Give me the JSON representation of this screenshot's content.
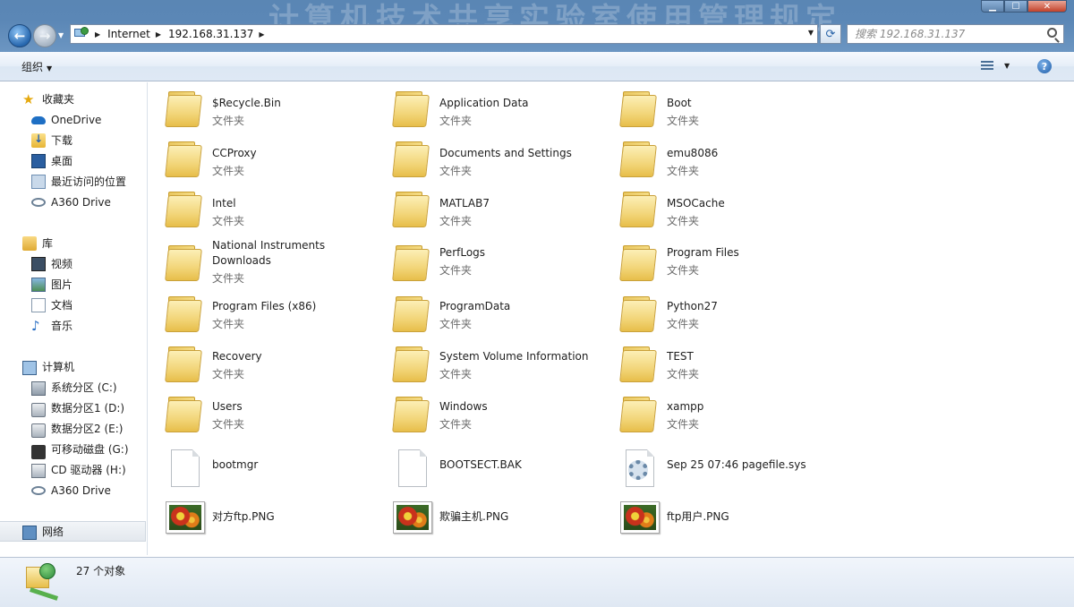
{
  "window": {
    "watermark": "计算机技术共享实验室使用管理规定"
  },
  "address": {
    "breadcrumbs": [
      "Internet",
      "192.168.31.137"
    ]
  },
  "search": {
    "placeholder": "搜索 192.168.31.137"
  },
  "toolbar": {
    "organize_label": "组织"
  },
  "sidebar": {
    "favorites": {
      "label": "收藏夹",
      "items": [
        {
          "label": "OneDrive",
          "icon": "cloud-icon"
        },
        {
          "label": "下载",
          "icon": "download-folder-icon"
        },
        {
          "label": "桌面",
          "icon": "desktop-icon"
        },
        {
          "label": "最近访问的位置",
          "icon": "recent-places-icon"
        },
        {
          "label": "A360 Drive",
          "icon": "a360-drive-icon"
        }
      ]
    },
    "libraries": {
      "label": "库",
      "items": [
        {
          "label": "视频",
          "icon": "video-icon"
        },
        {
          "label": "图片",
          "icon": "pictures-icon"
        },
        {
          "label": "文档",
          "icon": "documents-icon"
        },
        {
          "label": "音乐",
          "icon": "music-icon"
        }
      ]
    },
    "computer": {
      "label": "计算机",
      "items": [
        {
          "label": "系统分区 (C:)",
          "icon": "system-drive-icon"
        },
        {
          "label": "数据分区1 (D:)",
          "icon": "hard-drive-icon"
        },
        {
          "label": "数据分区2 (E:)",
          "icon": "hard-drive-icon"
        },
        {
          "label": "可移动磁盘 (G:)",
          "icon": "removable-drive-icon"
        },
        {
          "label": "CD 驱动器 (H:)",
          "icon": "cd-drive-icon"
        },
        {
          "label": "A360 Drive",
          "icon": "a360-drive-icon"
        }
      ]
    },
    "network": {
      "label": "网络"
    }
  },
  "files": [
    {
      "name": "$Recycle.Bin",
      "type": "文件夹",
      "kind": "folder"
    },
    {
      "name": "Application Data",
      "type": "文件夹",
      "kind": "folder"
    },
    {
      "name": "Boot",
      "type": "文件夹",
      "kind": "folder"
    },
    {
      "name": "CCProxy",
      "type": "文件夹",
      "kind": "folder"
    },
    {
      "name": "Documents and Settings",
      "type": "文件夹",
      "kind": "folder"
    },
    {
      "name": "emu8086",
      "type": "文件夹",
      "kind": "folder"
    },
    {
      "name": "Intel",
      "type": "文件夹",
      "kind": "folder"
    },
    {
      "name": "MATLAB7",
      "type": "文件夹",
      "kind": "folder"
    },
    {
      "name": "MSOCache",
      "type": "文件夹",
      "kind": "folder"
    },
    {
      "name": "National Instruments Downloads",
      "name_lines": [
        "National Instruments",
        "Downloads"
      ],
      "type": "文件夹",
      "kind": "folder"
    },
    {
      "name": "PerfLogs",
      "type": "文件夹",
      "kind": "folder"
    },
    {
      "name": "Program Files",
      "type": "文件夹",
      "kind": "folder"
    },
    {
      "name": "Program Files (x86)",
      "type": "文件夹",
      "kind": "folder"
    },
    {
      "name": "ProgramData",
      "type": "文件夹",
      "kind": "folder"
    },
    {
      "name": "Python27",
      "type": "文件夹",
      "kind": "folder"
    },
    {
      "name": "Recovery",
      "type": "文件夹",
      "kind": "folder"
    },
    {
      "name": "System Volume Information",
      "type": "文件夹",
      "kind": "folder"
    },
    {
      "name": "TEST",
      "type": "文件夹",
      "kind": "folder"
    },
    {
      "name": "Users",
      "type": "文件夹",
      "kind": "folder"
    },
    {
      "name": "Windows",
      "type": "文件夹",
      "kind": "folder"
    },
    {
      "name": "xampp",
      "type": "文件夹",
      "kind": "folder"
    },
    {
      "name": "bootmgr",
      "type": "",
      "kind": "file"
    },
    {
      "name": "BOOTSECT.BAK",
      "type": "",
      "kind": "file"
    },
    {
      "name": "Sep 25 07:46 pagefile.sys",
      "type": "",
      "kind": "system-file"
    },
    {
      "name": "对方ftp.PNG",
      "type": "",
      "kind": "image"
    },
    {
      "name": "欺骗主机.PNG",
      "type": "",
      "kind": "image"
    },
    {
      "name": "ftp用户.PNG",
      "type": "",
      "kind": "image"
    }
  ],
  "status": {
    "count_text": "27 个对象"
  }
}
